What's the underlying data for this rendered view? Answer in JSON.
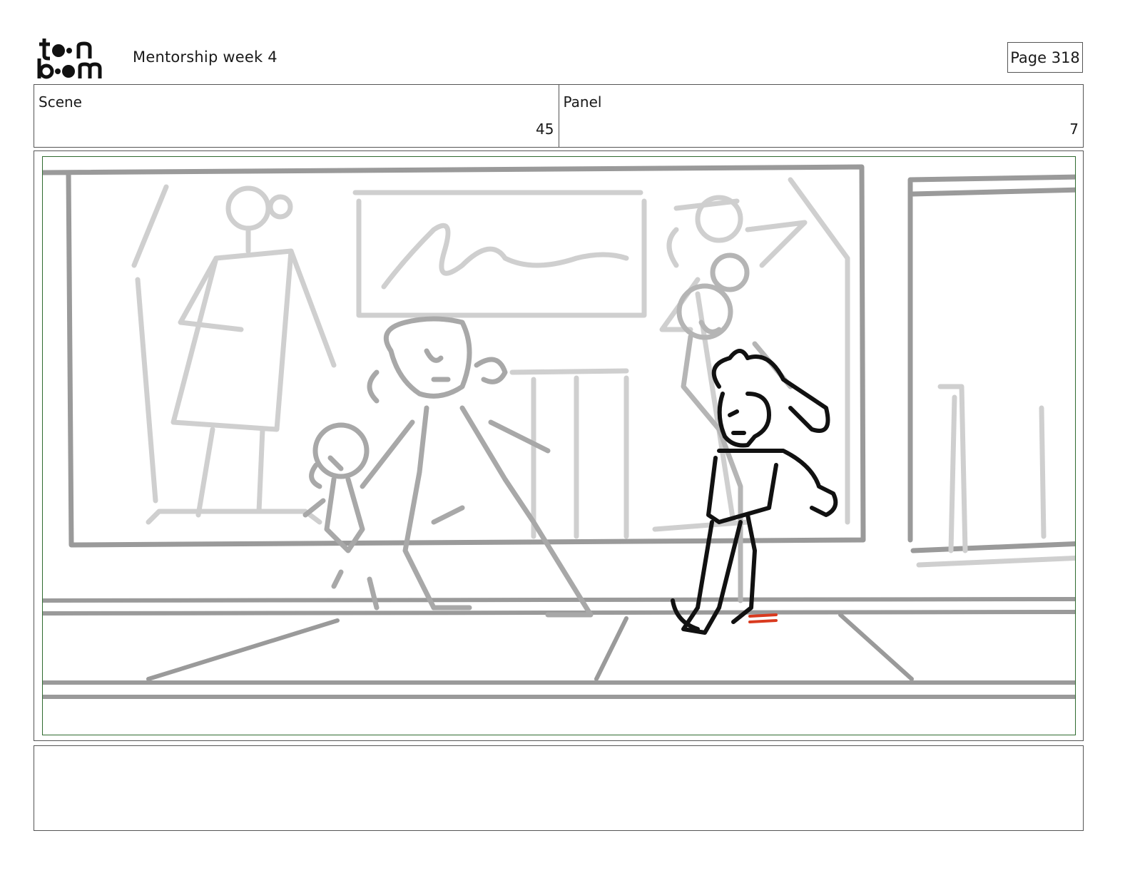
{
  "header": {
    "logo_text": "toon boom",
    "project_title": "Mentorship week 4",
    "page_label": "Page 318"
  },
  "info": {
    "scene_label": "Scene",
    "scene_value": "45",
    "panel_label": "Panel",
    "panel_value": "7"
  },
  "notes": {
    "text": ""
  },
  "colors": {
    "ink": "#111111",
    "sketch_gray": "#9a9a9a",
    "light_gray": "#c9c9c9",
    "safe_frame": "#2f6b2f",
    "accent_red": "#d93a1f"
  }
}
